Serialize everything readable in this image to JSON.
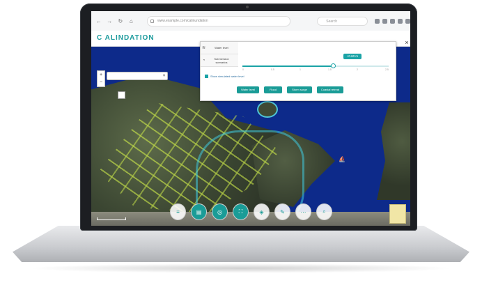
{
  "browser": {
    "url": "www.example.com/calinundation",
    "search_placeholder": "Search",
    "nav_back": "←",
    "nav_forward": "→",
    "nav_reload": "↻",
    "nav_home": "⌂"
  },
  "app": {
    "logo_text": "C ALINDATION"
  },
  "map": {
    "search_placeholder": "",
    "zoom_in": "+",
    "zoom_out": "−",
    "boat_symbol": "⛵"
  },
  "panel": {
    "close_label": "×",
    "tabs": [
      {
        "icon": "≋",
        "label": "Water level"
      },
      {
        "icon": "◔",
        "label": "Submersion scenarios"
      }
    ],
    "value_badge": "+0.60 m",
    "slider_value_fraction": 0.62,
    "slider_ticks": [
      "0",
      "0.5",
      "1",
      "1.5",
      "2",
      "2.5"
    ],
    "checkbox_label": "Show simulated water level",
    "checkbox_checked": true,
    "buttons": [
      "Water level",
      "Flood",
      "Storm surge",
      "Coastal retreat"
    ]
  },
  "toolbar": {
    "buttons": [
      {
        "icon": "≡",
        "active": false
      },
      {
        "icon": "▤",
        "active": true
      },
      {
        "icon": "◎",
        "active": true
      },
      {
        "icon": "⛶",
        "active": true
      },
      {
        "icon": "◈",
        "active": false
      },
      {
        "icon": "✎",
        "active": false
      },
      {
        "icon": "⋯",
        "active": false
      },
      {
        "icon": "⌕",
        "active": false
      }
    ]
  },
  "colors": {
    "accent": "#1a9c97",
    "water": "#0d2a8a",
    "flood_edge": "#40c8dc",
    "roads": "#cce84a"
  }
}
